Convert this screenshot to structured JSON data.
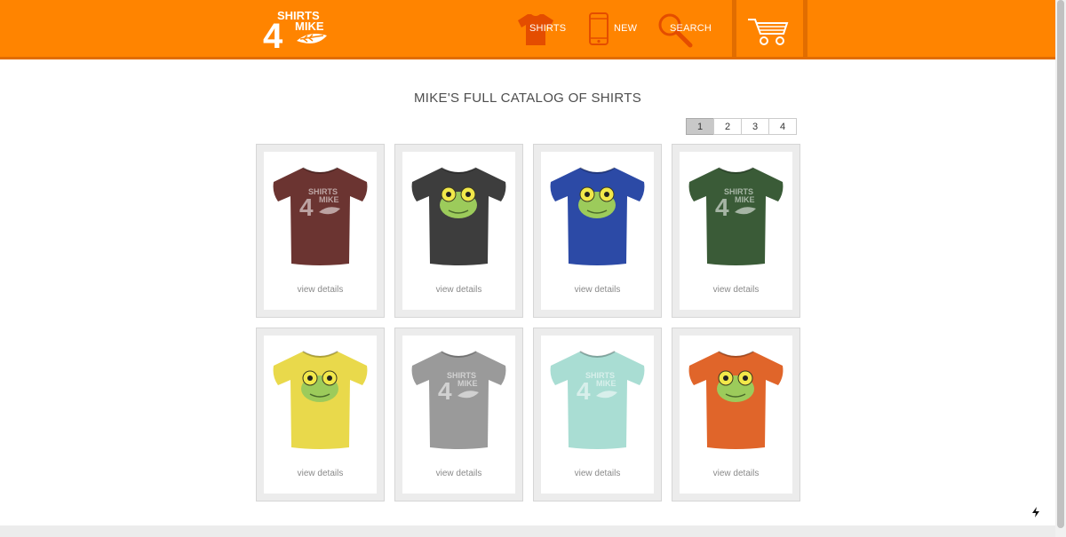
{
  "header": {
    "logo_text": [
      "SHIRTS",
      "4",
      "MIKE"
    ],
    "nav": [
      {
        "label": "SHIRTS",
        "icon": "shirt-icon"
      },
      {
        "label": "NEW",
        "icon": "phone-icon"
      },
      {
        "label": "SEARCH",
        "icon": "search-icon"
      }
    ],
    "cart_icon": "cart-icon"
  },
  "page_title": "MIKE'S FULL CATALOG OF SHIRTS",
  "pagination": {
    "pages": [
      "1",
      "2",
      "3",
      "4"
    ],
    "active": "1"
  },
  "products": [
    {
      "color": "#6b3431",
      "design": "logo",
      "link": "view details"
    },
    {
      "color": "#3d3d3d",
      "design": "frog",
      "link": "view details"
    },
    {
      "color": "#2c4aa6",
      "design": "frog",
      "link": "view details"
    },
    {
      "color": "#3a5b37",
      "design": "logo",
      "link": "view details"
    },
    {
      "color": "#e9d94b",
      "design": "frog",
      "link": "view details"
    },
    {
      "color": "#9a9a9a",
      "design": "logo",
      "link": "view details"
    },
    {
      "color": "#a9ddd3",
      "design": "logo",
      "link": "view details"
    },
    {
      "color": "#e0652a",
      "design": "frog",
      "link": "view details"
    }
  ],
  "colors": {
    "header_bg": "#ff8400",
    "header_border": "#e16d00",
    "accent_shirt_icon": "#e44d00"
  }
}
